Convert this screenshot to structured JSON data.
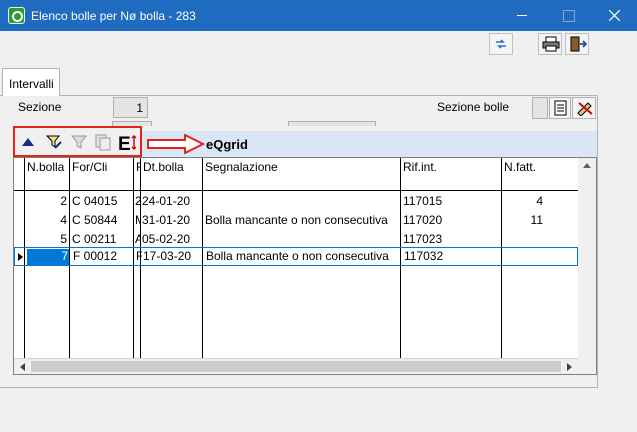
{
  "window": {
    "title": "Elenco bolle per Nø bolla - 283",
    "minimize": "minimize",
    "maximize": "maximize",
    "close": "close"
  },
  "tabs": [
    {
      "label": "Intervalli",
      "active": true
    }
  ],
  "form": {
    "sezione_label": "Sezione",
    "sezione_value": "1",
    "sezione_bolle_label": "Sezione bolle"
  },
  "annotation": {
    "grid_name": "eQgrid",
    "highlight_color": "#e2231a"
  },
  "grid_toolbar": {
    "icons": [
      "sort-ascending-icon",
      "filter-edit-icon",
      "filter-icon",
      "copy-columns-icon",
      "column-resize-icon"
    ]
  },
  "grid": {
    "columns": [
      "N.bolla",
      "For/Cli",
      "R",
      "Dt.bolla",
      "Segnalazione",
      "Rif.int.",
      "N.fatt."
    ],
    "rows": [
      {
        "n_bolla": "2",
        "for_cli": "C 04015",
        "r": "2",
        "dt_bolla": "24-01-20",
        "segnalazione": "",
        "rif_int": "117015",
        "n_fatt": "4",
        "selected": false
      },
      {
        "n_bolla": "4",
        "for_cli": "C 50844",
        "r": "M",
        "dt_bolla": "31-01-20",
        "segnalazione": "Bolla mancante o non consecutiva",
        "rif_int": "117020",
        "n_fatt": "11",
        "selected": false
      },
      {
        "n_bolla": "5",
        "for_cli": "C 00211",
        "r": "A",
        "dt_bolla": "05-02-20",
        "segnalazione": "",
        "rif_int": "117023",
        "n_fatt": "",
        "selected": false
      },
      {
        "n_bolla": "7",
        "for_cli": "F 00012",
        "r": "F",
        "dt_bolla": "17-03-20",
        "segnalazione": "Bolla mancante o non consecutiva",
        "rif_int": "117032",
        "n_fatt": "",
        "selected": true
      }
    ]
  },
  "colors": {
    "titlebar": "#1f6bbf",
    "selection": "#0078d7",
    "grid_header_band": "#d8e6f5"
  }
}
